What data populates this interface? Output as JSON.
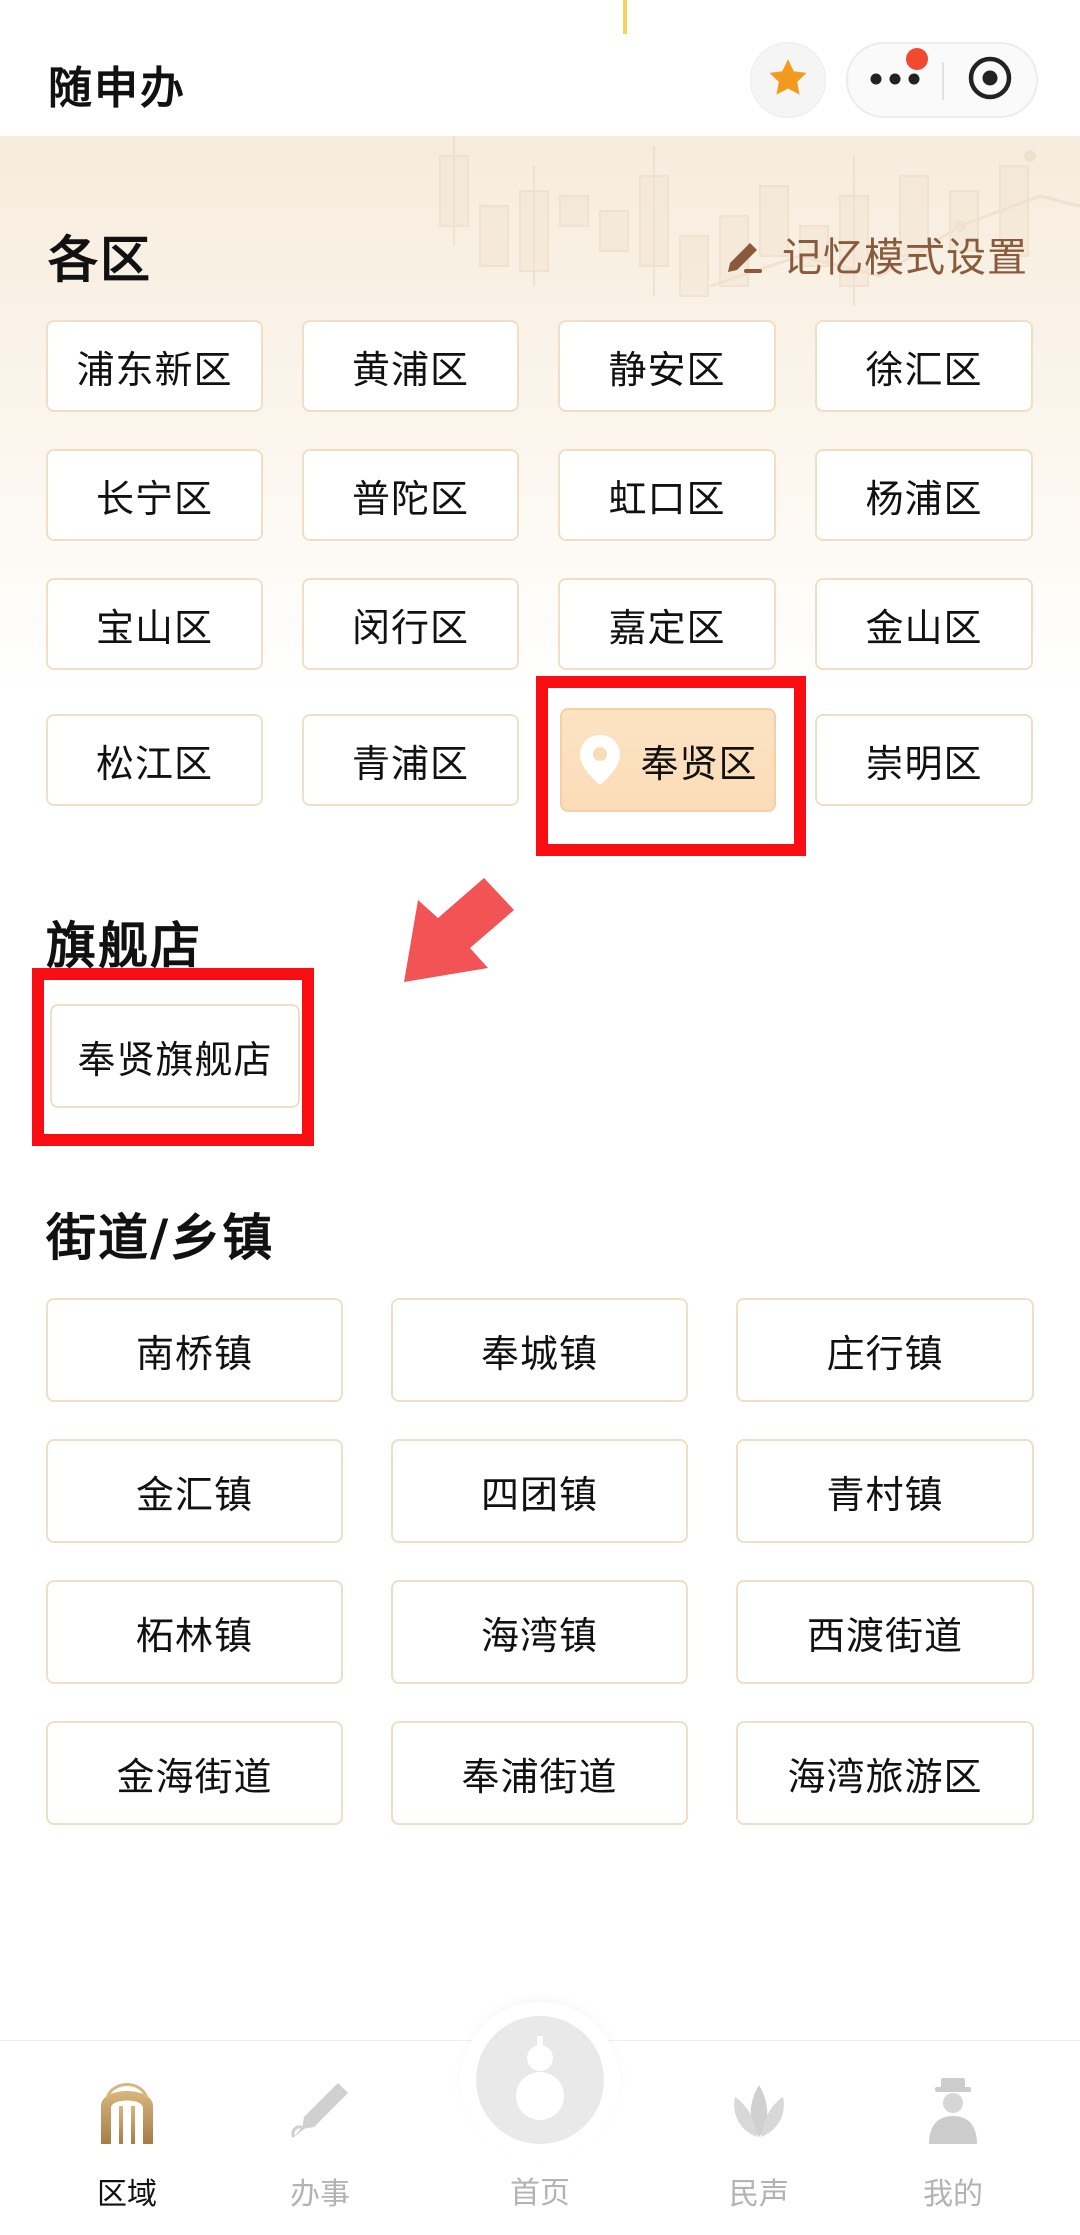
{
  "header": {
    "title": "随申办",
    "favorite_icon": "star-icon",
    "more_icon": "more-dots-icon",
    "close_icon": "target-close-icon",
    "accent_star": "#f39a1e",
    "notice_dot": "#f24a2f"
  },
  "districts": {
    "title": "各区",
    "memory_setting": "记忆模式设置",
    "items": [
      "浦东新区",
      "黄浦区",
      "静安区",
      "徐汇区",
      "长宁区",
      "普陀区",
      "虹口区",
      "杨浦区",
      "宝山区",
      "闵行区",
      "嘉定区",
      "金山区",
      "松江区",
      "青浦区",
      "奉贤区",
      "崇明区"
    ],
    "selected": "奉贤区"
  },
  "flagship": {
    "title": "旗舰店",
    "items": [
      "奉贤旗舰店"
    ]
  },
  "towns": {
    "title": "街道/乡镇",
    "items": [
      "南桥镇",
      "奉城镇",
      "庄行镇",
      "金汇镇",
      "四团镇",
      "青村镇",
      "柘林镇",
      "海湾镇",
      "西渡街道",
      "金海街道",
      "奉浦街道",
      "海湾旅游区"
    ]
  },
  "tabbar": {
    "items": [
      {
        "label": "区域",
        "icon": "archway-icon",
        "active": true
      },
      {
        "label": "办事",
        "icon": "pen-icon",
        "active": false
      },
      {
        "label": "首页",
        "icon": "gourd-icon",
        "active": false
      },
      {
        "label": "民声",
        "icon": "magnolia-icon",
        "active": false
      },
      {
        "label": "我的",
        "icon": "person-icon",
        "active": false
      }
    ]
  },
  "colors": {
    "chip_border": "#f0dfc4",
    "selected_chip": "#fde3c3",
    "annotation_red": "#f70d12",
    "memory_link": "#8a5a3c"
  }
}
